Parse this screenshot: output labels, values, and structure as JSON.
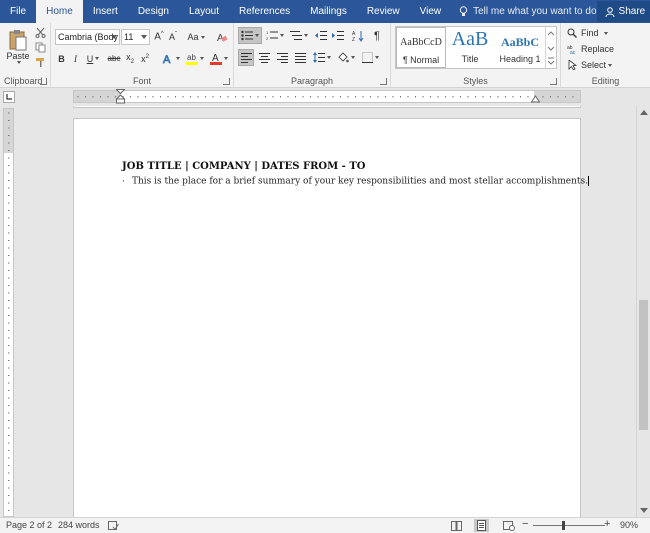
{
  "tabs": [
    {
      "label": "File",
      "active": false
    },
    {
      "label": "Home",
      "active": true
    },
    {
      "label": "Insert",
      "active": false
    },
    {
      "label": "Design",
      "active": false
    },
    {
      "label": "Layout",
      "active": false
    },
    {
      "label": "References",
      "active": false
    },
    {
      "label": "Mailings",
      "active": false
    },
    {
      "label": "Review",
      "active": false
    },
    {
      "label": "View",
      "active": false
    }
  ],
  "tell_me": "Tell me what you want to do",
  "share_label": "Share",
  "ribbon": {
    "clipboard": {
      "label": "Clipboard",
      "paste_label": "Paste"
    },
    "font": {
      "label": "Font",
      "font_name": "Cambria (Body",
      "font_size": "11",
      "font_color": "#e03c31",
      "highlight_color": "#ffff00"
    },
    "paragraph": {
      "label": "Paragraph"
    },
    "styles": {
      "label": "Styles",
      "items": [
        {
          "preview": "AaBbCcD",
          "name": "¶ Normal"
        },
        {
          "preview": "AaB",
          "name": "Title"
        },
        {
          "preview": "AaBbC",
          "name": "Heading 1"
        }
      ],
      "heading_color": "#2e74b5"
    },
    "editing": {
      "label": "Editing",
      "find": "Find",
      "replace": "Replace",
      "select": "Select"
    }
  },
  "document": {
    "job_title": "JOB TITLE | COMPANY | DATES FROM - TO",
    "bullet": "·",
    "summary": "This is the place for a brief summary of your key responsibilities and most stellar accomplishments."
  },
  "status": {
    "page": "Page 2 of 2",
    "words": "284 words",
    "zoom": "90%",
    "zoom_minus": "−",
    "zoom_plus": "+"
  },
  "colors": {
    "brand": "#2b579a"
  }
}
